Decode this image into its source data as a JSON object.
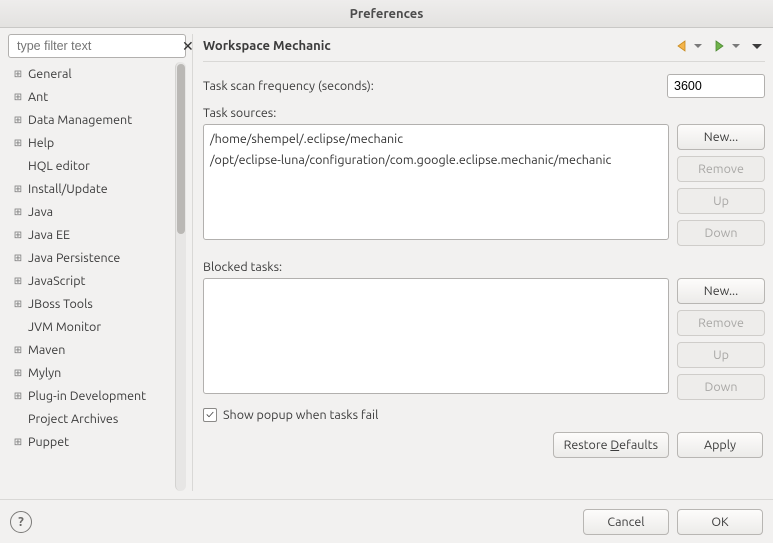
{
  "window": {
    "title": "Preferences"
  },
  "filter": {
    "placeholder": "type filter text"
  },
  "tree": {
    "items": [
      {
        "label": "General",
        "expandable": true
      },
      {
        "label": "Ant",
        "expandable": true
      },
      {
        "label": "Data Management",
        "expandable": true
      },
      {
        "label": "Help",
        "expandable": true
      },
      {
        "label": "HQL editor",
        "expandable": false
      },
      {
        "label": "Install/Update",
        "expandable": true
      },
      {
        "label": "Java",
        "expandable": true
      },
      {
        "label": "Java EE",
        "expandable": true
      },
      {
        "label": "Java Persistence",
        "expandable": true
      },
      {
        "label": "JavaScript",
        "expandable": true
      },
      {
        "label": "JBoss Tools",
        "expandable": true
      },
      {
        "label": "JVM Monitor",
        "expandable": false
      },
      {
        "label": "Maven",
        "expandable": true
      },
      {
        "label": "Mylyn",
        "expandable": true
      },
      {
        "label": "Plug-in Development",
        "expandable": true
      },
      {
        "label": "Project Archives",
        "expandable": false
      },
      {
        "label": "Puppet",
        "expandable": true
      }
    ]
  },
  "page": {
    "title": "Workspace Mechanic"
  },
  "freq": {
    "label": "Task scan frequency (seconds):",
    "value": "3600"
  },
  "sources": {
    "label": "Task sources:",
    "items": [
      "/home/shempel/.eclipse/mechanic",
      "/opt/eclipse-luna/configuration/com.google.eclipse.mechanic/mechanic"
    ],
    "buttons": {
      "new": "New...",
      "remove": "Remove",
      "up": "Up",
      "down": "Down"
    }
  },
  "blocked": {
    "label": "Blocked tasks:",
    "items": [],
    "buttons": {
      "new": "New...",
      "remove": "Remove",
      "up": "Up",
      "down": "Down"
    }
  },
  "checkbox": {
    "label": "Show popup when tasks fail",
    "checked": true
  },
  "actions": {
    "restore": "Restore Defaults",
    "apply": "Apply"
  },
  "bottom": {
    "cancel": "Cancel",
    "ok": "OK"
  }
}
